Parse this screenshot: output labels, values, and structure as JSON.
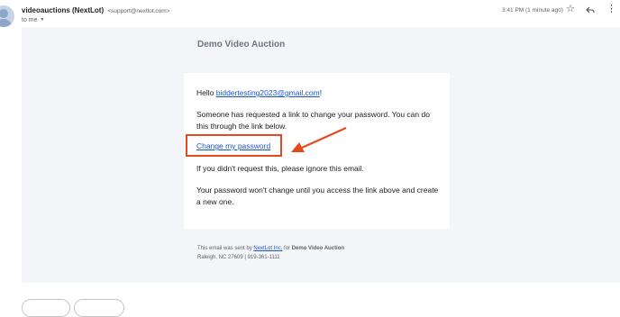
{
  "header": {
    "sender_name": "videoauctions (NextLot)",
    "sender_email": "<support@nextlot.com>",
    "recipient": "to me",
    "timestamp": "3:41 PM (1 minute ago)"
  },
  "email": {
    "brand_title": "Demo Video Auction",
    "greeting_prefix": "Hello ",
    "greeting_email": "biddertesting2023@gmail.com",
    "greeting_suffix": "!",
    "paragraph1": "Someone has requested a link to change your password. You can do this through the link below.",
    "change_link": "Change my password",
    "paragraph2": "If you didn't request this, please ignore this email.",
    "paragraph3": "Your password won't change until you access the link above and create a new one.",
    "footer_prefix": "This email was sent by ",
    "footer_company": "NextLot Inc.",
    "footer_mid": " for ",
    "footer_brand": "Demo Video Auction",
    "footer_address": "Raleigh, NC 27609 | 919-361-1111"
  },
  "annotation": {
    "color": "#e34a1e"
  },
  "icons": [
    "avatar",
    "chevron-down-icon",
    "star-icon",
    "reply-icon",
    "more-vert-icon",
    "arrow-annotation"
  ]
}
